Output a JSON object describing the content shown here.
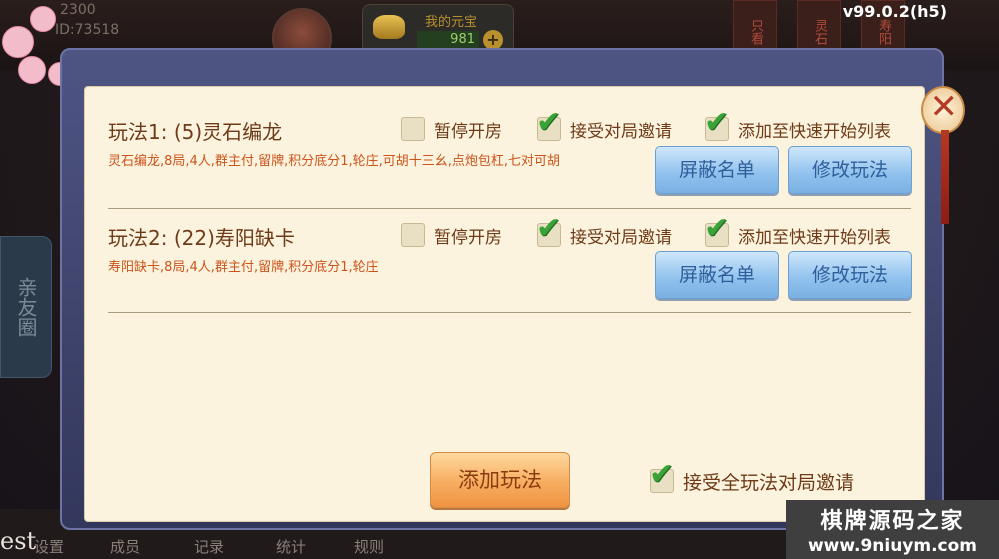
{
  "top": {
    "stat_score": "2300",
    "stat_id": "ID:73518",
    "yuanbao_label": "我的元宝",
    "yuanbao_value": "981",
    "yuanbao_plus": "+",
    "version": "v99.0.2(h5)",
    "cards": [
      "只看",
      "灵石",
      "寿阳"
    ]
  },
  "left_tab": {
    "label": "亲友圈"
  },
  "dialog": {
    "close_icon": "lantern-close-icon",
    "rules": [
      {
        "title": "玩法1:  (5)灵石编龙",
        "desc": "灵石编龙,8局,4人,群主付,留牌,积分底分1,轮庄,可胡十三幺,点炮包杠,七对可胡",
        "pause_label": "暂停开房",
        "pause_checked": false,
        "accept_label": "接受对局邀请",
        "accept_checked": true,
        "quick_label": "添加至快速开始列表",
        "quick_checked": true,
        "block_button": "屏蔽名单",
        "edit_button": "修改玩法"
      },
      {
        "title": "玩法2:  (22)寿阳缺卡",
        "desc": "寿阳缺卡,8局,4人,群主付,留牌,积分底分1,轮庄",
        "pause_label": "暂停开房",
        "pause_checked": false,
        "accept_label": "接受对局邀请",
        "accept_checked": true,
        "quick_label": "添加至快速开始列表",
        "quick_checked": true,
        "block_button": "屏蔽名单",
        "edit_button": "修改玩法"
      }
    ],
    "add_button": "添加玩法",
    "accept_all_label": "接受全玩法对局邀请",
    "accept_all_checked": true
  },
  "bottom": {
    "tabs": [
      "设置",
      "成员",
      "记录",
      "统计",
      "规则"
    ],
    "letters": "est"
  },
  "watermark": {
    "line1": "棋牌源码之家",
    "line2": "www.9niuym.com"
  },
  "colors": {
    "panel_bg": "#fbf3dd",
    "title_brown": "#6e3a17",
    "desc_orange": "#cc531b",
    "check_green": "#39a338",
    "button_blue": "#93c3ee",
    "button_orange": "#f7ad60"
  }
}
